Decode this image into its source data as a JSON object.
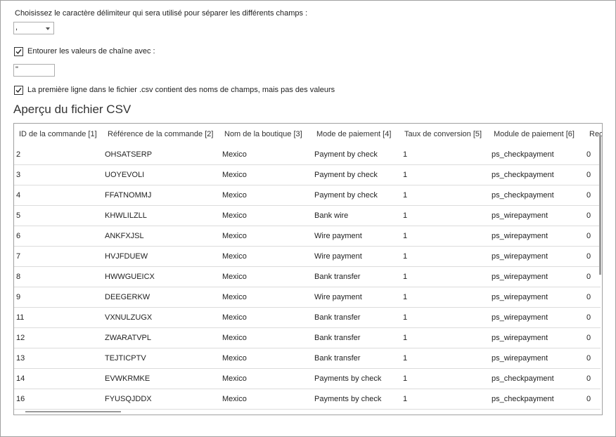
{
  "form": {
    "delimiter_label": "Choisissez le caractère délimiteur qui sera utilisé pour séparer les différents champs :",
    "delimiter_value": ",",
    "enclose_label": "Entourer les valeurs de chaîne avec :",
    "enclose_checked": true,
    "enclose_value": "\"",
    "header_label": "La première ligne dans le fichier .csv contient des noms de champs, mais pas des valeurs",
    "header_checked": true
  },
  "preview": {
    "title": "Aperçu du fichier CSV",
    "columns": [
      "ID de la commande [1]",
      "Référence de la commande [2]",
      "Nom de la boutique [3]",
      "Mode de paiement [4]",
      "Taux de conversion [5]",
      "Module de paiement [6]",
      "Rec"
    ],
    "rows": [
      [
        "2",
        "OHSATSERP",
        "Mexico",
        "Payment by check",
        "1",
        "ps_checkpayment",
        "0"
      ],
      [
        "3",
        "UOYEVOLI",
        "Mexico",
        "Payment by check",
        "1",
        "ps_checkpayment",
        "0"
      ],
      [
        "4",
        "FFATNOMMJ",
        "Mexico",
        "Payment by check",
        "1",
        "ps_checkpayment",
        "0"
      ],
      [
        "5",
        "KHWLILZLL",
        "Mexico",
        "Bank wire",
        "1",
        "ps_wirepayment",
        "0"
      ],
      [
        "6",
        "ANKFXJSL",
        "Mexico",
        "Wire payment",
        "1",
        "ps_wirepayment",
        "0"
      ],
      [
        "7",
        "HVJFDUEW",
        "Mexico",
        "Wire payment",
        "1",
        "ps_wirepayment",
        "0"
      ],
      [
        "8",
        "HWWGUEICX",
        "Mexico",
        "Bank transfer",
        "1",
        "ps_wirepayment",
        "0"
      ],
      [
        "9",
        "DEEGERKW",
        "Mexico",
        "Wire payment",
        "1",
        "ps_wirepayment",
        "0"
      ],
      [
        "11",
        "VXNULZUGX",
        "Mexico",
        "Bank transfer",
        "1",
        "ps_wirepayment",
        "0"
      ],
      [
        "12",
        "ZWARATVPL",
        "Mexico",
        "Bank transfer",
        "1",
        "ps_wirepayment",
        "0"
      ],
      [
        "13",
        "TEJTICPTV",
        "Mexico",
        "Bank transfer",
        "1",
        "ps_wirepayment",
        "0"
      ],
      [
        "14",
        "EVWKRMKE",
        "Mexico",
        "Payments by check",
        "1",
        "ps_checkpayment",
        "0"
      ],
      [
        "16",
        "FYUSQJDDX",
        "Mexico",
        "Payments by check",
        "1",
        "ps_checkpayment",
        "0"
      ]
    ]
  }
}
